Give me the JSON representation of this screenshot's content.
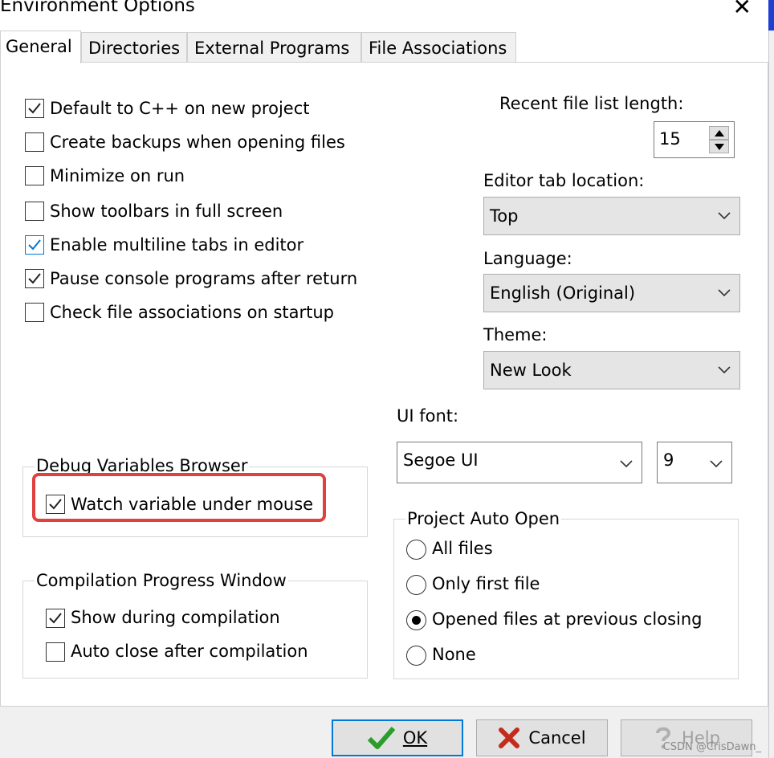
{
  "window": {
    "title": "Environment Options",
    "close_symbol": "✕"
  },
  "tabs": [
    {
      "label": "General",
      "active": true
    },
    {
      "label": "Directories",
      "active": false
    },
    {
      "label": "External Programs",
      "active": false
    },
    {
      "label": "File Associations",
      "active": false
    }
  ],
  "options": [
    {
      "label": "Default to C++ on new project",
      "checked": true
    },
    {
      "label": "Create backups when opening files",
      "checked": false
    },
    {
      "label": "Minimize on run",
      "checked": false
    },
    {
      "label": "Show toolbars in full screen",
      "checked": false
    },
    {
      "label": "Enable multiline tabs in editor",
      "checked": true
    },
    {
      "label": "Pause console programs after return",
      "checked": true
    },
    {
      "label": "Check file associations on startup",
      "checked": false
    }
  ],
  "recent_files": {
    "label": "Recent file list length:",
    "value": "15"
  },
  "editor_tab": {
    "label": "Editor tab location:",
    "value": "Top"
  },
  "language": {
    "label": "Language:",
    "value": "English (Original)"
  },
  "theme": {
    "label": "Theme:",
    "value": "New Look"
  },
  "ui_font": {
    "label": "UI font:",
    "font_value": "Segoe UI",
    "size_value": "9"
  },
  "debug_group": {
    "title": "Debug Variables Browser",
    "watch_label": "Watch variable under mouse",
    "watch_checked": true
  },
  "compilation_group": {
    "title": "Compilation Progress Window",
    "show_label": "Show during compilation",
    "show_checked": true,
    "autoclose_label": "Auto close after compilation",
    "autoclose_checked": false
  },
  "project_auto_open": {
    "title": "Project Auto Open",
    "options": [
      {
        "label": "All files",
        "selected": false
      },
      {
        "label": "Only first file",
        "selected": false
      },
      {
        "label": "Opened files at previous closing",
        "selected": true
      },
      {
        "label": "None",
        "selected": false
      }
    ]
  },
  "buttons": {
    "ok": "OK",
    "cancel": "Cancel",
    "help": "Help"
  },
  "watermark": "CSDN @CrisDawn_",
  "colors": {
    "highlight": "#e0413f",
    "focus_blue": "#0078d7",
    "ok_green": "#2a9d2a",
    "cancel_red": "#c42b1c"
  }
}
